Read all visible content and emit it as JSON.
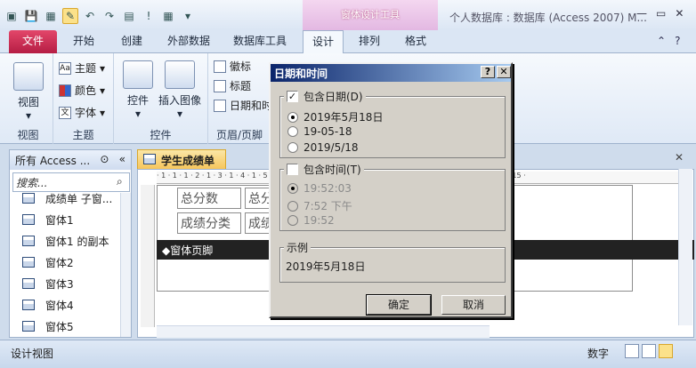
{
  "titlebar": {
    "context_tool": "窗体设计工具",
    "window_title": "个人数据库 : 数据库 (Access 2007) M...",
    "minimize": "—",
    "restore": "▭",
    "close": "✕"
  },
  "tabs": [
    {
      "label": "文件"
    },
    {
      "label": "开始"
    },
    {
      "label": "创建"
    },
    {
      "label": "外部数据"
    },
    {
      "label": "数据库工具"
    },
    {
      "label": "设计"
    },
    {
      "label": "排列"
    },
    {
      "label": "格式"
    }
  ],
  "ribbon": {
    "view_button": "视图",
    "theme_items": [
      "主题",
      "颜色",
      "字体"
    ],
    "controls_button": "控件",
    "insert_image_button": "插入图像",
    "header_items": [
      "徽标",
      "标题",
      "日期和时"
    ],
    "group_labels": [
      "视图",
      "主题",
      "控件",
      "页眉/页脚"
    ]
  },
  "nav": {
    "header": "所有 Access ...",
    "search_placeholder": "搜索...",
    "items": [
      "成绩单 子窗...",
      "窗体1",
      "窗体1 的副本",
      "窗体2",
      "窗体3",
      "窗体4",
      "窗体5"
    ]
  },
  "document": {
    "tab_label": "学生成绩单",
    "controls": [
      "总分数",
      "总分",
      "成绩分类",
      "成绩"
    ],
    "footer_label": "◆窗体页脚"
  },
  "status": {
    "left": "设计视图",
    "right": "数字"
  },
  "dialog": {
    "title": "日期和时间",
    "help": "?",
    "close": "✕",
    "include_date_label": "包含日期(D)",
    "include_date_checked": true,
    "date_options": [
      "2019年5月18日",
      "19-05-18",
      "2019/5/18"
    ],
    "date_selected": 0,
    "include_time_label": "包含时间(T)",
    "include_time_checked": false,
    "time_options": [
      "19:52:03",
      "7:52 下午",
      "19:52"
    ],
    "example_label": "示例",
    "example_value": "2019年5月18日",
    "ok_label": "确定",
    "cancel_label": "取消"
  }
}
